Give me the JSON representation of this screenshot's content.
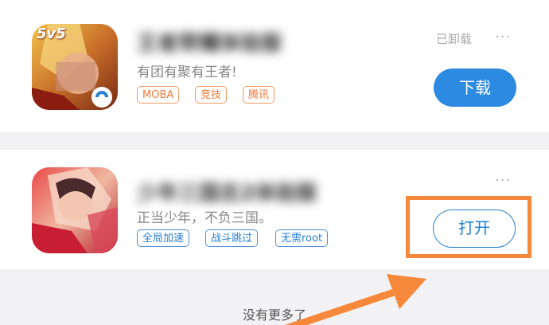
{
  "apps": [
    {
      "title": "王者荣耀体验服",
      "icon_badge": "5v5",
      "description": "有团有聚有王者!",
      "tags": [
        "MOBA",
        "竞技",
        "腾讯"
      ],
      "status": "已卸载",
      "button": "下载"
    },
    {
      "title": "少年三国志2体验服",
      "description": "正当少年，不负三国。",
      "tags": [
        "全局加速",
        "战斗跳过",
        "无需root"
      ],
      "button": "打开"
    }
  ],
  "more_icon": "···",
  "footer": "没有更多了",
  "colors": {
    "accent": "#2c8ae0",
    "highlight": "#f5883a",
    "tag_orange": "#f07a38",
    "tag_blue": "#2a7fd0"
  }
}
